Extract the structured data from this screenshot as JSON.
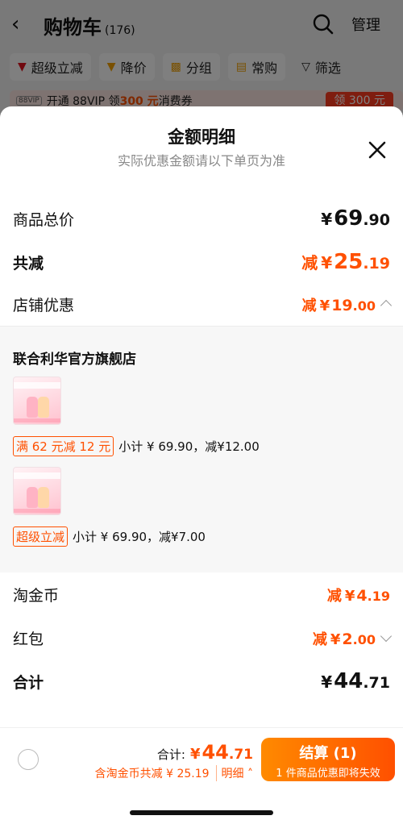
{
  "background_page": {
    "title": "购物车",
    "count": "(176)",
    "manage_label": "管理",
    "filters": [
      {
        "label": "超级立减",
        "icon": "down-arrow-red-icon"
      },
      {
        "label": "降价",
        "icon": "down-arrow-gold-icon"
      },
      {
        "label": "分组",
        "icon": "folder-icon"
      },
      {
        "label": "常购",
        "icon": "cart-icon"
      },
      {
        "label": "筛选",
        "icon": "funnel-icon"
      }
    ],
    "vip_banner": {
      "badge": "88VIP",
      "text_before": "开通 88VIP 领",
      "amount": "300 元",
      "text_after": "消费券",
      "button": "领 300 元"
    }
  },
  "sheet": {
    "title": "金额明细",
    "subtitle": "实际优惠金额请以下单页为准",
    "total_goods": {
      "label": "商品总价",
      "currency": "¥",
      "int": "69",
      "dec": ".90"
    },
    "total_discount": {
      "label": "共减",
      "prefix": "减",
      "currency": "¥",
      "int": "25",
      "dec": ".19"
    },
    "store_discount": {
      "label": "店铺优惠",
      "prefix": "减",
      "currency": "¥",
      "int": "19",
      "dec": ".00"
    },
    "store": {
      "name": "联合利华官方旗舰店",
      "items": [
        {
          "tag": "满 62 元减 12 元",
          "text": "小计 ¥ 69.90，减¥12.00"
        },
        {
          "tag": "超级立减",
          "text": "小计 ¥ 69.90，减¥7.00"
        }
      ]
    },
    "coins": {
      "label": "淘金币",
      "prefix": "减",
      "currency": "¥",
      "int": "4",
      "dec": ".19"
    },
    "red_packet": {
      "label": "红包",
      "prefix": "减",
      "currency": "¥",
      "int": "2",
      "dec": ".00"
    },
    "sum": {
      "label": "合计",
      "currency": "¥",
      "int": "44",
      "dec": ".71"
    }
  },
  "bottom_bar": {
    "total_label": "合计:",
    "total_currency": "¥",
    "total_int": "44",
    "total_dec": ".71",
    "savings_text": "含淘金币共减 ¥ 25.19",
    "detail_link": "明细",
    "checkout_label": "结算 (1)",
    "checkout_sub": "1 件商品优惠即将失效"
  },
  "colors": {
    "accent": "#ff5000",
    "dim": "rgba(0,0,0,0.5)"
  }
}
